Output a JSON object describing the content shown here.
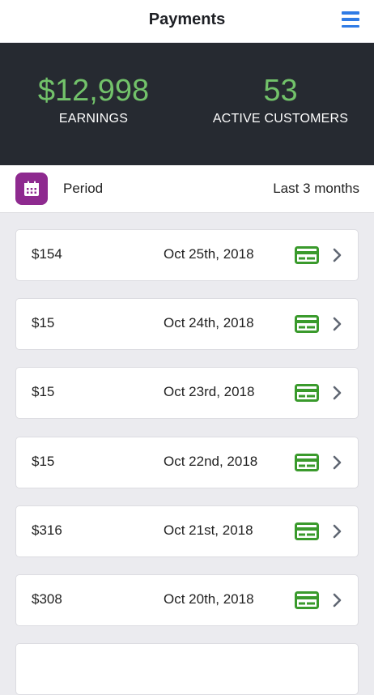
{
  "header": {
    "title": "Payments",
    "menu_icon": "hamburger-menu-icon"
  },
  "stats": {
    "earnings_value": "$12,998",
    "earnings_label": "EARNINGS",
    "customers_value": "53",
    "customers_label": "ACTIVE CUSTOMERS"
  },
  "period": {
    "label": "Period",
    "value": "Last 3 months",
    "icon": "calendar-icon"
  },
  "payments": [
    {
      "amount": "$154",
      "date": "Oct 25th, 2018"
    },
    {
      "amount": "$15",
      "date": "Oct 24th, 2018"
    },
    {
      "amount": "$15",
      "date": "Oct 23rd, 2018"
    },
    {
      "amount": "$15",
      "date": "Oct 22nd, 2018"
    },
    {
      "amount": "$316",
      "date": "Oct 21st, 2018"
    },
    {
      "amount": "$308",
      "date": "Oct 20th, 2018"
    },
    {
      "amount": "",
      "date": ""
    }
  ],
  "colors": {
    "accent_green": "#72c26a",
    "card_green": "#3a9a2c",
    "header_dark": "#262a31",
    "menu_blue": "#2f7be5",
    "calendar_purple": "#8e2a8f"
  }
}
